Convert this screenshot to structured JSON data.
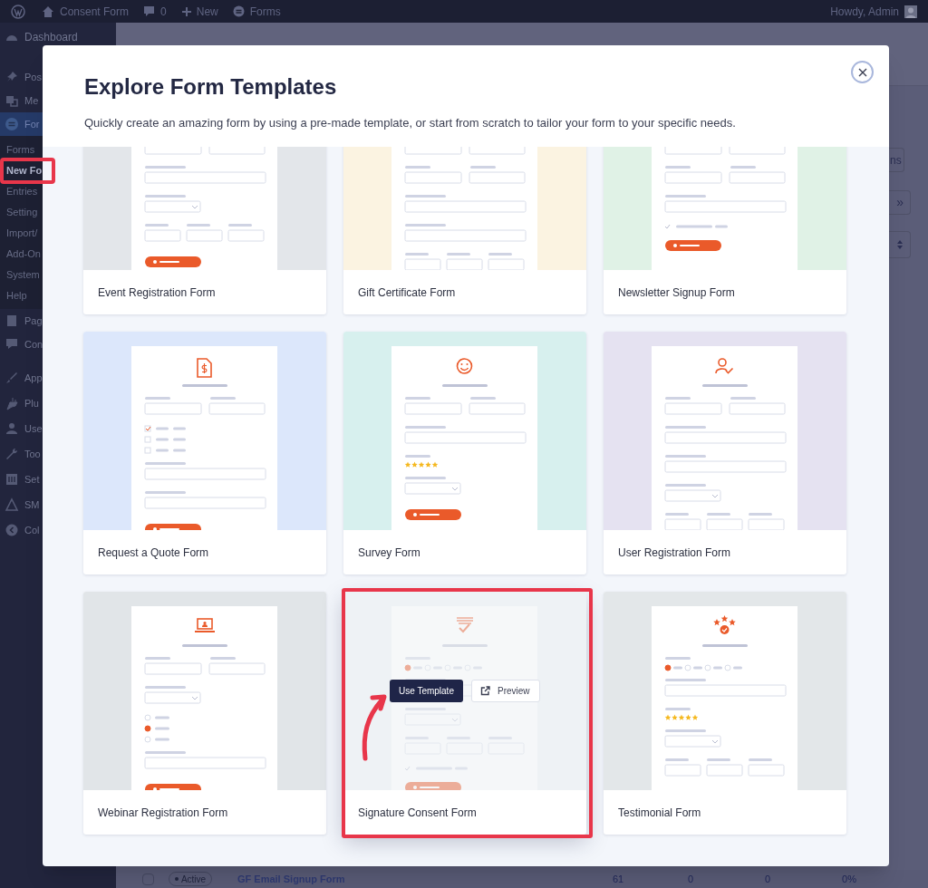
{
  "admin_bar": {
    "site": "Consent Form",
    "comments": "0",
    "new": "New",
    "forms": "Forms",
    "greeting": "Howdy, Admin"
  },
  "sidebar": {
    "items": [
      {
        "label": "Dashboard",
        "kind": "menu",
        "selected": false
      },
      {
        "label": "Pos",
        "kind": "menu",
        "selected": false
      },
      {
        "label": "Me",
        "kind": "menu",
        "selected": false
      },
      {
        "label": "For",
        "kind": "menu",
        "selected": true
      },
      {
        "label": "Forms",
        "kind": "submenu",
        "selected": false
      },
      {
        "label": "New Fo",
        "kind": "submenu",
        "selected": true
      },
      {
        "label": "Entries",
        "kind": "submenu",
        "selected": false
      },
      {
        "label": "Setting",
        "kind": "submenu",
        "selected": false
      },
      {
        "label": "Import/",
        "kind": "submenu",
        "selected": false
      },
      {
        "label": "Add-On",
        "kind": "submenu",
        "selected": false
      },
      {
        "label": "System",
        "kind": "submenu",
        "selected": false
      },
      {
        "label": "Help",
        "kind": "submenu",
        "selected": false
      },
      {
        "label": "Pag",
        "kind": "menu",
        "selected": false
      },
      {
        "label": "Con",
        "kind": "menu",
        "selected": false
      },
      {
        "label": "App",
        "kind": "menu",
        "selected": false
      },
      {
        "label": "Plu",
        "kind": "menu",
        "selected": false
      },
      {
        "label": "Use",
        "kind": "menu",
        "selected": false
      },
      {
        "label": "Too",
        "kind": "menu",
        "selected": false
      },
      {
        "label": "Set",
        "kind": "menu",
        "selected": false
      },
      {
        "label": "SM",
        "kind": "menu",
        "selected": false
      },
      {
        "label": "Col",
        "kind": "menu",
        "selected": false
      }
    ]
  },
  "background": {
    "toolbar": [
      "ns",
      "»"
    ],
    "row": {
      "checked": false,
      "status": "Active",
      "name": "GF Email Signup Form",
      "cells": [
        "61",
        "0",
        "0",
        "0%"
      ]
    }
  },
  "modal": {
    "title": "Explore Form Templates",
    "subtitle": "Quickly create an amazing form by using a pre-made template, or start from scratch to tailor your form to your specific needs.",
    "card_actions": {
      "use": "Use Template",
      "preview": "Preview"
    },
    "cards": [
      {
        "title": "Event Registration Form",
        "kind": "event",
        "color": "#e3e6ea",
        "hovered": false
      },
      {
        "title": "Gift Certificate Form",
        "kind": "gift",
        "color": "#fbf3e1",
        "hovered": false
      },
      {
        "title": "Newsletter Signup Form",
        "kind": "newsletter",
        "color": "#e0f2e6",
        "hovered": false
      },
      {
        "title": "Request a Quote Form",
        "kind": "quote",
        "color": "#dce7fb",
        "hovered": false
      },
      {
        "title": "Survey Form",
        "kind": "survey",
        "color": "#d7f0ee",
        "hovered": false
      },
      {
        "title": "User Registration Form",
        "kind": "user",
        "color": "#e5e2f1",
        "hovered": false
      },
      {
        "title": "Webinar Registration Form",
        "kind": "webinar",
        "color": "#e1e5e8",
        "hovered": false
      },
      {
        "title": "Signature Consent Form",
        "kind": "signature",
        "color": "#eef2f5",
        "hovered": true
      },
      {
        "title": "Testimonial Form",
        "kind": "testimonial",
        "color": "#e3e7e9",
        "hovered": false
      }
    ]
  }
}
